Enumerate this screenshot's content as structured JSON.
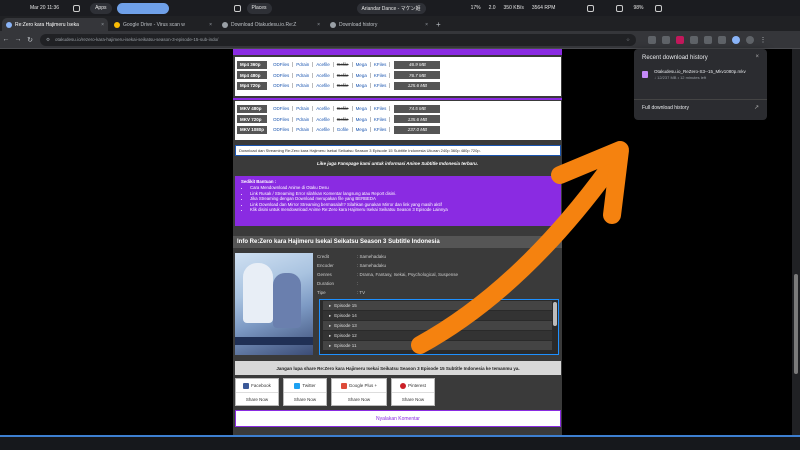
{
  "system_bar": {
    "date": "Mar 20 11:36",
    "apps_label": "Apps",
    "places_label": "Places",
    "media": "Ariandar Dance - マケン姫",
    "cpu": "17%",
    "mem": "2.0",
    "net": "350 KB/s",
    "fan": "3564 RPM",
    "battery": "98%"
  },
  "tabs": [
    {
      "label": "Re:Zero kara Hajimeru Iseka",
      "active": true
    },
    {
      "label": "Google Drive - Virus scan w",
      "active": false
    },
    {
      "label": "Download Otakudesu.io.Re:Z",
      "active": false
    },
    {
      "label": "Download history",
      "active": false
    }
  ],
  "address_bar": {
    "url": "otakudesu.io/rezero-kara-hajimeru-isekai-seikatsu-season-3-episode-15-sub-indo/"
  },
  "downloads": {
    "mp4": [
      {
        "format": "Mp4 360p",
        "links": [
          "ODFiles",
          "Pdrain",
          "Acefile",
          "Gofile",
          "Mega",
          "KFiles"
        ],
        "size": "46.9 MB"
      },
      {
        "format": "Mp4 480p",
        "links": [
          "ODFiles",
          "Pdrain",
          "Acefile",
          "Gofile",
          "Mega",
          "KFiles"
        ],
        "size": "76.7 MB"
      },
      {
        "format": "Mp4 720p",
        "links": [
          "ODFiles",
          "Pdrain",
          "Acefile",
          "Gofile",
          "Mega",
          "KFiles"
        ],
        "size": "125.6 MB"
      }
    ],
    "mkv": [
      {
        "format": "MKV 480p",
        "links": [
          "ODFiles",
          "Pdrain",
          "Acefile",
          "Gofile",
          "Mega",
          "KFiles"
        ],
        "size": "74.5 MB"
      },
      {
        "format": "MKV 720p",
        "links": [
          "ODFiles",
          "Pdrain",
          "Acefile",
          "Gofile",
          "Mega",
          "KFiles"
        ],
        "size": "135.6 MB"
      },
      {
        "format": "MKV 1080p",
        "links": [
          "ODFiles",
          "Pdrain",
          "Acefile",
          "Gofile",
          "Mega",
          "KFiles"
        ],
        "size": "237.0 MB"
      }
    ],
    "strike_link": "Gofile"
  },
  "download_text": "Download dan Streaming Re:Zero kara Hajimeru Isekai Seikatsu Season 3 Episode 15 Subtitle Indonesia Ukuran 240p 360p 480p 720p.",
  "fanpage_text": "Like juga Fanspage kami untuk informasi Anime Subtitle Indonesia terbaru.",
  "help": {
    "title": "Sedikit Bantuan :",
    "items": [
      "Cara Mendownload Anime di Otaku Desu",
      "Link Rusak / Streaming Error silahkan Komentar langsung atau Report disini.",
      "Jika Streaming dengan Download merupakan file yang BERBEDA",
      "Link Download dan Mirror Streaming bermasalah? Silahkan gunakan Mirror dan link yang masih aktif",
      "Klik disini untuk mendownload Anime Re:Zero kara Hajimeru Isekai Seikatsu Season 3 Episode Lainnya"
    ]
  },
  "info": {
    "header": "Info Re:Zero kara Hajimeru Isekai Seikatsu Season 3 Subtitle Indonesia",
    "rows": [
      {
        "key": "Credit",
        "value": ": Samehadaku"
      },
      {
        "key": "Encoder",
        "value": ": Samehadaku"
      },
      {
        "key": "Genres",
        "value": ": Drama, Fantasy, Isekai, Psychological, Suspense"
      },
      {
        "key": "Duration",
        "value": ":"
      },
      {
        "key": "Tipe",
        "value": ": TV"
      }
    ],
    "episodes": [
      "Episode 15",
      "Episode 14",
      "Episode 13",
      "Episode 12",
      "Episode 11"
    ]
  },
  "share": {
    "banner": "Jangan lupa share Re:Zero kara Hajimeru Isekai Seikatsu Season 3 Episode 15 Subtitle Indonesia ke temanmu ya.",
    "buttons": [
      {
        "label": "Facebook",
        "action": "Share Now",
        "color": "#3b5998"
      },
      {
        "label": "Twitter",
        "action": "Share Now",
        "color": "#1da1f2"
      },
      {
        "label": "Google Plus +",
        "action": "Share Now",
        "color": "#dd4b39"
      },
      {
        "label": "Pinterest",
        "action": "Share Now",
        "color": "#cb2027"
      }
    ],
    "comment_button": "Nyalakan Komentar"
  },
  "download_popup": {
    "title": "Recent download history",
    "file_name": "Otakudesu.io_ReZero-S3--15_Mkv1080p.mkv",
    "file_meta": "↓ 12/237 MB • 12 minutes left",
    "full_history": "Full download history"
  },
  "colors": {
    "accent_purple": "#8a2be2",
    "arrow_orange": "#f5820f"
  }
}
